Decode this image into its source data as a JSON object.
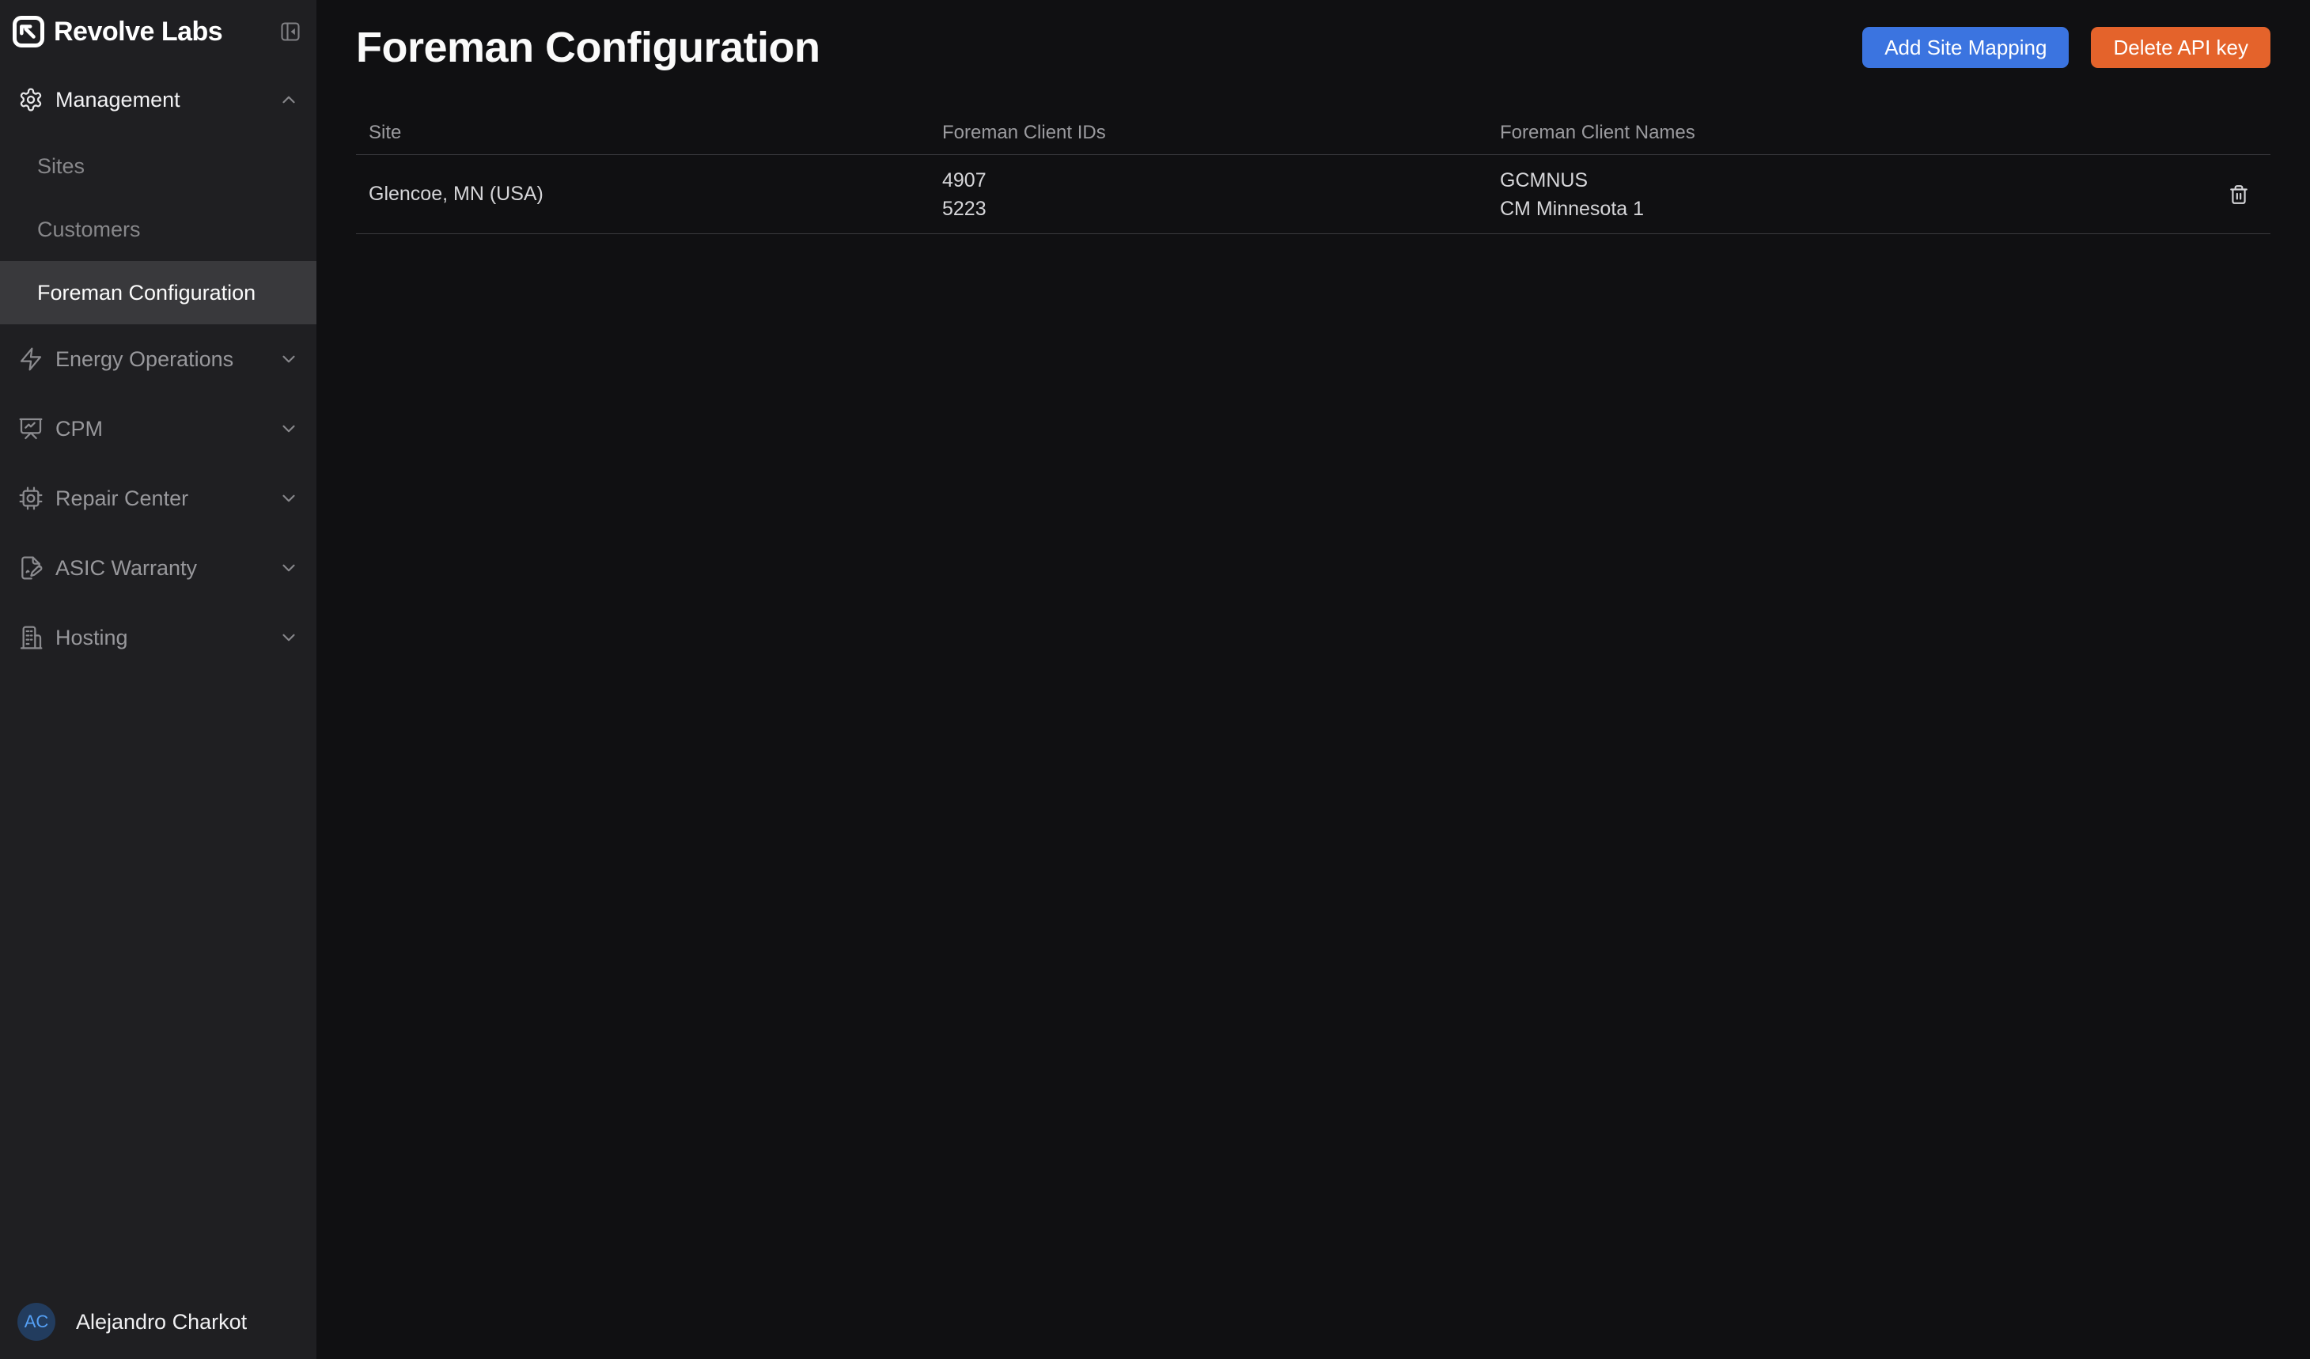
{
  "sidebar": {
    "brand": "Revolve Labs",
    "nav": [
      {
        "label": "Management",
        "icon": "gear-icon",
        "state": "expanded",
        "children": [
          {
            "label": "Sites",
            "active": false
          },
          {
            "label": "Customers",
            "active": false
          },
          {
            "label": "Foreman Configuration",
            "active": true
          }
        ]
      },
      {
        "label": "Energy Operations",
        "icon": "zap-icon",
        "state": "collapsed"
      },
      {
        "label": "CPM",
        "icon": "presentation-chart-icon",
        "state": "collapsed"
      },
      {
        "label": "Repair Center",
        "icon": "cpu-icon",
        "state": "collapsed"
      },
      {
        "label": "ASIC Warranty",
        "icon": "file-pen-icon",
        "state": "collapsed"
      },
      {
        "label": "Hosting",
        "icon": "building-icon",
        "state": "collapsed"
      }
    ],
    "user": {
      "initials": "AC",
      "name": "Alejandro Charkot"
    }
  },
  "header": {
    "title": "Foreman Configuration",
    "add_site_mapping_label": "Add Site Mapping",
    "delete_api_key_label": "Delete API key"
  },
  "table": {
    "columns": [
      "Site",
      "Foreman Client IDs",
      "Foreman Client Names"
    ],
    "rows": [
      {
        "site": "Glencoe, MN (USA)",
        "client_ids": [
          "4907",
          "5223"
        ],
        "client_names": [
          "GCMNUS",
          "CM Minnesota 1"
        ]
      }
    ]
  },
  "colors": {
    "sidebar_bg": "#1f1f22",
    "main_bg": "#101012",
    "active_item_bg": "#39393c",
    "accent_blue": "#3b74e0",
    "accent_orange": "#e4632b",
    "avatar_bg": "#223c5e",
    "avatar_text": "#55a0f5",
    "border": "#3a3a3e"
  }
}
